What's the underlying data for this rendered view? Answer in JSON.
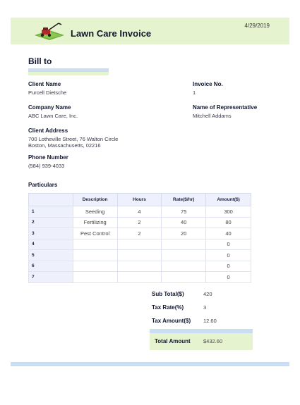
{
  "header": {
    "title": "Lawn Care Invoice",
    "date": "4/29/2019",
    "logo_icon": "lawn-mower-icon"
  },
  "bill_to": {
    "heading": "Bill to",
    "client_name_label": "Client Name",
    "client_name": "Purcell Dietsche",
    "invoice_no_label": "Invoice No.",
    "invoice_no": "1",
    "company_name_label": "Company Name",
    "company_name": "ABC Lawn Care, Inc.",
    "representative_label": "Name of Representative",
    "representative": "Mitchell Addams",
    "address_label": "Client Address",
    "address_line1": "700 Lotheville Street, 76 Walton Circle",
    "address_line2": "Boston, Massachusetts, 02216",
    "phone_label": "Phone Number",
    "phone": "(584) 939-4033"
  },
  "particulars": {
    "heading": "Particulars",
    "columns": [
      "",
      "Description",
      "Hours",
      "Rate($/hr)",
      "Amount($)"
    ],
    "rows": [
      {
        "num": "1",
        "description": "Seeding",
        "hours": "4",
        "rate": "75",
        "amount": "300"
      },
      {
        "num": "2",
        "description": "Fertilizing",
        "hours": "2",
        "rate": "40",
        "amount": "80"
      },
      {
        "num": "3",
        "description": "Pest Control",
        "hours": "2",
        "rate": "20",
        "amount": "40"
      },
      {
        "num": "4",
        "description": "",
        "hours": "",
        "rate": "",
        "amount": "0"
      },
      {
        "num": "5",
        "description": "",
        "hours": "",
        "rate": "",
        "amount": "0"
      },
      {
        "num": "6",
        "description": "",
        "hours": "",
        "rate": "",
        "amount": "0"
      },
      {
        "num": "7",
        "description": "",
        "hours": "",
        "rate": "",
        "amount": "0"
      }
    ]
  },
  "summary": {
    "subtotal_label": "Sub Total($)",
    "subtotal": "420",
    "tax_rate_label": "Tax Rate(%)",
    "tax_rate": "3",
    "tax_amount_label": "Tax Amount($)",
    "tax_amount": "12.60",
    "total_label": "Total Amount",
    "total": "$432.60"
  },
  "colors": {
    "band_green": "#e5f4cf",
    "band_blue": "#c9def3",
    "header_cell": "#eef0fb"
  }
}
